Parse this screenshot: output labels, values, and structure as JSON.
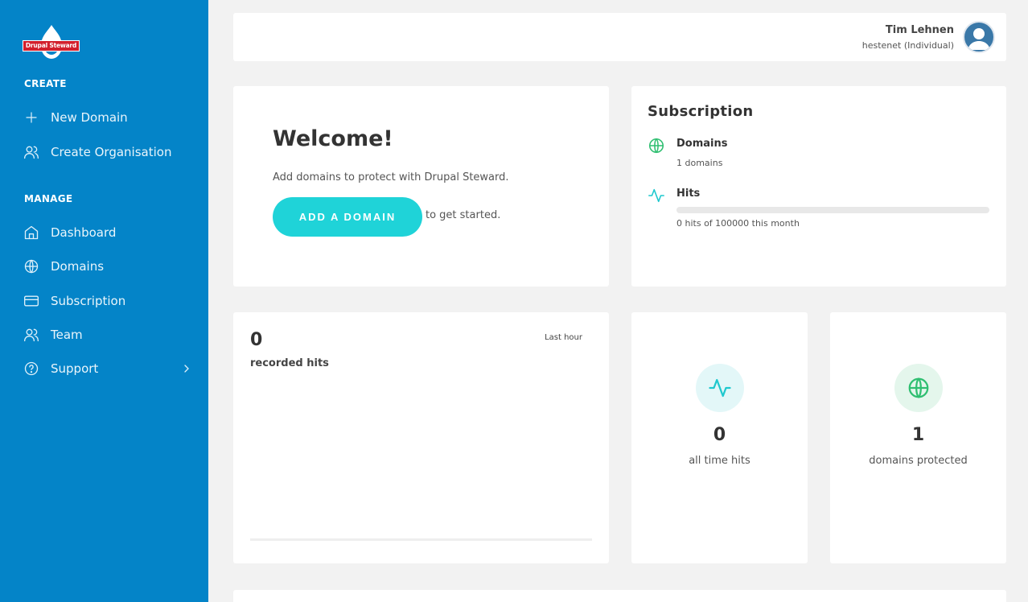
{
  "brand": {
    "logo_text": "Drupal Steward",
    "accent": "#1fd3d8",
    "sidebar_color": "#0484c8"
  },
  "sidebar": {
    "create_title": "CREATE",
    "create_items": [
      {
        "label": "New Domain",
        "icon": "plus-icon"
      },
      {
        "label": "Create Organisation",
        "icon": "users-icon"
      }
    ],
    "manage_title": "MANAGE",
    "manage_items": [
      {
        "label": "Dashboard",
        "icon": "home-icon"
      },
      {
        "label": "Domains",
        "icon": "globe-icon"
      },
      {
        "label": "Subscription",
        "icon": "credit-card-icon"
      },
      {
        "label": "Team",
        "icon": "users-icon"
      },
      {
        "label": "Support",
        "icon": "help-circle-icon"
      }
    ]
  },
  "user": {
    "name": "Tim Lehnen",
    "org": "hestenet (Individual)"
  },
  "welcome": {
    "title": "Welcome!",
    "intro": "Add domains to protect with Drupal Steward.",
    "button_label": "ADD A DOMAIN",
    "after_button": "to get started."
  },
  "subscription": {
    "title": "Subscription",
    "domains_title": "Domains",
    "domains_text": "1 domains",
    "hits_title": "Hits",
    "hits_text": "0 hits of 100000 this month",
    "hits_used": 0,
    "hits_limit": 100000
  },
  "recorded": {
    "value": "0",
    "label": "recorded hits",
    "period": "Last hour"
  },
  "stats": {
    "all_time_hits": {
      "value": "0",
      "label": "all time hits",
      "icon": "activity-icon"
    },
    "domains_protected": {
      "value": "1",
      "label": "domains protected",
      "icon": "globe-icon"
    }
  }
}
